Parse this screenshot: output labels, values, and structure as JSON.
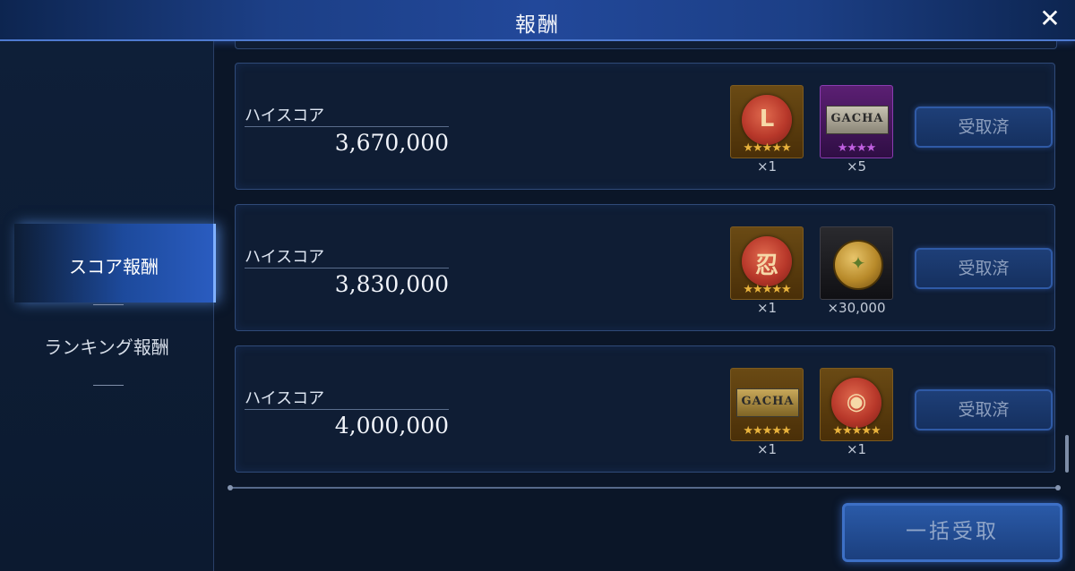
{
  "header": {
    "title": "報酬"
  },
  "sidebar": {
    "tabs": [
      {
        "label": "スコア報酬",
        "active": true
      },
      {
        "label": "ランキング報酬",
        "active": false
      }
    ]
  },
  "rewards": [
    {
      "label": "ハイスコア",
      "score": "3,670,000",
      "items": [
        {
          "icon": "red-seal-icon",
          "glyph": "L",
          "stars": "★★★★★",
          "star_color": "gold",
          "qty": "×1"
        },
        {
          "icon": "gacha-ticket-icon",
          "text": "GACHA",
          "stars": "★★★★",
          "star_color": "purple",
          "qty": "×5"
        }
      ],
      "status": "受取済"
    },
    {
      "label": "ハイスコア",
      "score": "3,830,000",
      "items": [
        {
          "icon": "red-seal-icon",
          "glyph": "忍",
          "stars": "★★★★★",
          "star_color": "gold",
          "qty": "×1"
        },
        {
          "icon": "gold-coin-icon",
          "glyph": "✦",
          "stars": "",
          "star_color": "",
          "qty": "×30,000"
        }
      ],
      "status": "受取済"
    },
    {
      "label": "ハイスコア",
      "score": "4,000,000",
      "items": [
        {
          "icon": "gacha-ticket-gold-icon",
          "text": "GACHA",
          "stars": "★★★★★",
          "star_color": "gold",
          "qty": "×1"
        },
        {
          "icon": "red-seal-icon",
          "glyph": "◉",
          "stars": "★★★★★",
          "star_color": "gold",
          "qty": "×1"
        }
      ],
      "status": "受取済"
    }
  ],
  "footer": {
    "claim_all": "一括受取"
  },
  "colors": {
    "accent": "#2a5cc0",
    "panel": "#0f1d34",
    "star_gold": "#e8b23c",
    "star_purple": "#c05fe0"
  }
}
